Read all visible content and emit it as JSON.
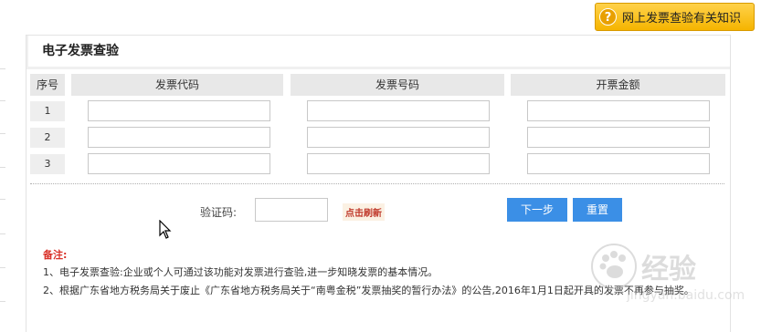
{
  "help_button": {
    "label": "网上发票查验有关知识",
    "icon": "question-icon",
    "icon_glyph": "?"
  },
  "panel": {
    "title": "电子发票查验",
    "columns": [
      "序号",
      "发票代码",
      "发票号码",
      "开票金额"
    ],
    "rows": [
      {
        "index": "1",
        "code": "",
        "number": "",
        "amount": ""
      },
      {
        "index": "2",
        "code": "",
        "number": "",
        "amount": ""
      },
      {
        "index": "3",
        "code": "",
        "number": "",
        "amount": ""
      }
    ]
  },
  "captcha": {
    "label": "验证码:",
    "value": "",
    "refresh_label": "点击刷新"
  },
  "buttons": {
    "next": "下一步",
    "reset": "重置"
  },
  "notes": {
    "title": "备注:",
    "items": [
      "1、电子发票查验:企业或个人可通过该功能对发票进行查验,进一步知晓发票的基本情况。",
      "2、根据广东省地方税务局关于废止《广东省地方税务局关于“南粤金税”发票抽奖的暂行办法》的公告,2016年1月1日起开具的发票不再参与抽奖。"
    ]
  },
  "watermark": {
    "cn": "经验",
    "en": "jingyan.baidu.com"
  },
  "colors": {
    "accent_blue": "#3b8fe6",
    "help_yellow": "#f5b400",
    "note_red": "#d9322a"
  }
}
